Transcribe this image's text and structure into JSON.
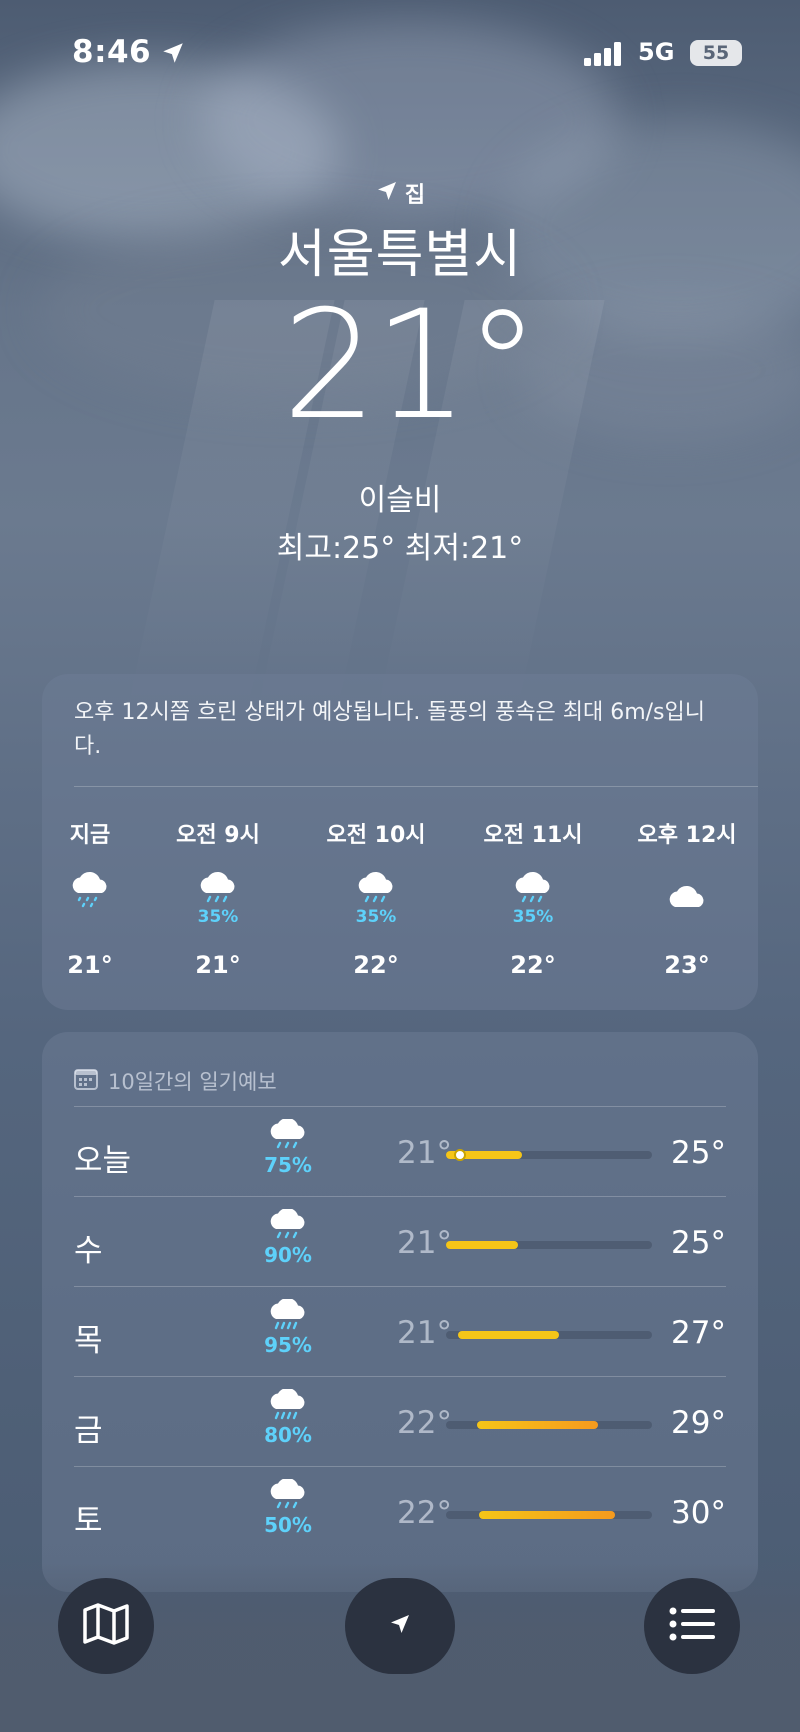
{
  "status_bar": {
    "time": "8:46",
    "network": "5G",
    "battery": "55"
  },
  "header": {
    "home_label": "집",
    "city": "서울특별시",
    "temperature": "21°",
    "condition": "이슬비",
    "hilo": "최고:25°  최저:21°"
  },
  "hourly": {
    "summary": "오후 12시쯤 흐린 상태가 예상됩니다. 돌풍의 풍속은 최대 6m/s입니다.",
    "hours": [
      {
        "label": "지금",
        "icon": "cloud-drizzle-icon",
        "pop": "",
        "temp": "21°"
      },
      {
        "label": "오전 9시",
        "icon": "cloud-rain-icon",
        "pop": "35%",
        "temp": "21°"
      },
      {
        "label": "오전 10시",
        "icon": "cloud-rain-icon",
        "pop": "35%",
        "temp": "22°"
      },
      {
        "label": "오전 11시",
        "icon": "cloud-rain-icon",
        "pop": "35%",
        "temp": "22°"
      },
      {
        "label": "오후 12시",
        "icon": "cloud-icon",
        "pop": "",
        "temp": "23°"
      }
    ]
  },
  "daily": {
    "title": "10일간의 일기예보",
    "days": [
      {
        "name": "오늘",
        "icon": "cloud-rain-icon",
        "pop": "75%",
        "low": "21°",
        "high": "25°",
        "range_start": 0.0,
        "range_end": 0.37,
        "current": 0.07
      },
      {
        "name": "수",
        "icon": "cloud-rain-icon",
        "pop": "90%",
        "low": "21°",
        "high": "25°",
        "range_start": 0.0,
        "range_end": 0.35
      },
      {
        "name": "목",
        "icon": "cloud-heavy-rain-icon",
        "pop": "95%",
        "low": "21°",
        "high": "27°",
        "range_start": 0.06,
        "range_end": 0.55
      },
      {
        "name": "금",
        "icon": "cloud-heavy-rain-icon",
        "pop": "80%",
        "low": "22°",
        "high": "29°",
        "range_start": 0.15,
        "range_end": 0.74
      },
      {
        "name": "토",
        "icon": "cloud-rain-icon",
        "pop": "50%",
        "low": "22°",
        "high": "30°",
        "range_start": 0.16,
        "range_end": 0.82
      }
    ]
  },
  "colors": {
    "pop": "#5ed1fa",
    "bar_yellow": "#f5c518",
    "bar_orange": "#f59a1e"
  },
  "toolbar": {
    "left_icon": "map-icon",
    "center_icon": "location-arrow-icon",
    "right_icon": "list-icon"
  }
}
